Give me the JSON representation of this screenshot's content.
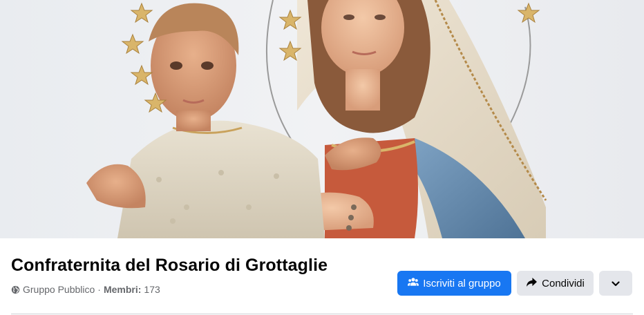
{
  "group": {
    "title": "Confraternita del Rosario di Grottaglie",
    "privacy": "Gruppo Pubblico",
    "separator": "·",
    "members_label": "Membri:",
    "members_count": "173"
  },
  "actions": {
    "join_label": "Iscriviti al gruppo",
    "share_label": "Condividi"
  },
  "icons": {
    "privacy": "globe-icon",
    "join": "group-icon",
    "share": "share-arrow-icon",
    "more": "chevron-down-icon"
  },
  "colors": {
    "primary": "#1877f2",
    "secondary_button": "#e4e6eb",
    "text_primary": "#050505",
    "text_secondary": "#65676b"
  }
}
